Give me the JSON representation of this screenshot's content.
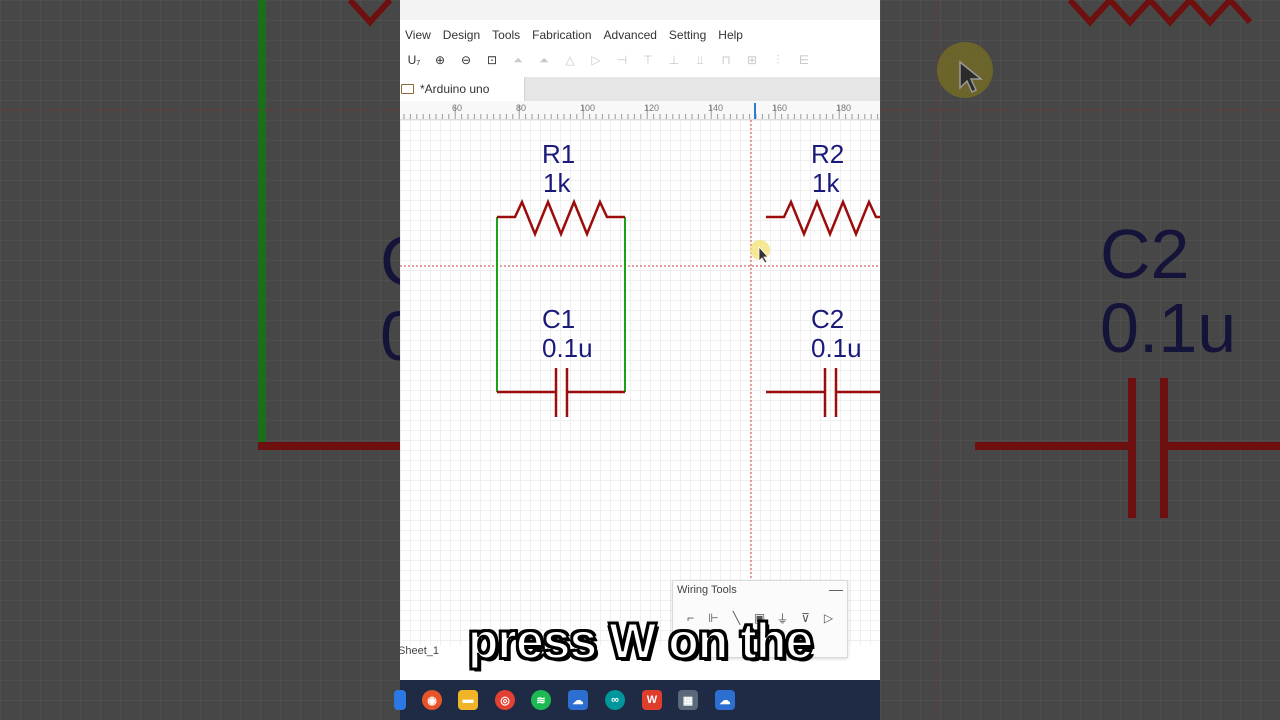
{
  "menu": [
    "View",
    "Design",
    "Tools",
    "Fabrication",
    "Advanced",
    "Setting",
    "Help"
  ],
  "tab": {
    "title": "*Arduino uno"
  },
  "ruler": {
    "ticks": [
      "60",
      "80",
      "100",
      "120",
      "140",
      "160",
      "180"
    ]
  },
  "components": {
    "r1": {
      "ref": "R1",
      "value": "1k"
    },
    "r2": {
      "ref": "R2",
      "value": "1k"
    },
    "c1": {
      "ref": "C1",
      "value": "0.1u"
    },
    "c2": {
      "ref": "C2",
      "value": "0.1u"
    }
  },
  "wiring_tools": {
    "title": "Wiring Tools",
    "minimize": "—"
  },
  "sheet": "Sheet_1",
  "caption": "press W on the",
  "backdrop": {
    "right_ref": "C2",
    "right_value": "0.1u",
    "left_ref": "C",
    "left_value": "0"
  },
  "colors": {
    "wire": "#1aa31a",
    "part": "#9b0d0d",
    "label": "#1a1a7a",
    "crosshair": "#d04040",
    "taskbar": "#1f2a44"
  },
  "toolbar_icons": [
    "text-tool-icon",
    "zoom-in-icon",
    "zoom-out-icon",
    "fit-view-icon",
    "align-icon"
  ],
  "taskbar_icons": [
    "firefox-icon",
    "files-icon",
    "chrome-icon",
    "spotify-icon",
    "easyeda-icon",
    "arduino-icon",
    "wps-icon",
    "calculator-icon",
    "easyeda-active-icon"
  ]
}
